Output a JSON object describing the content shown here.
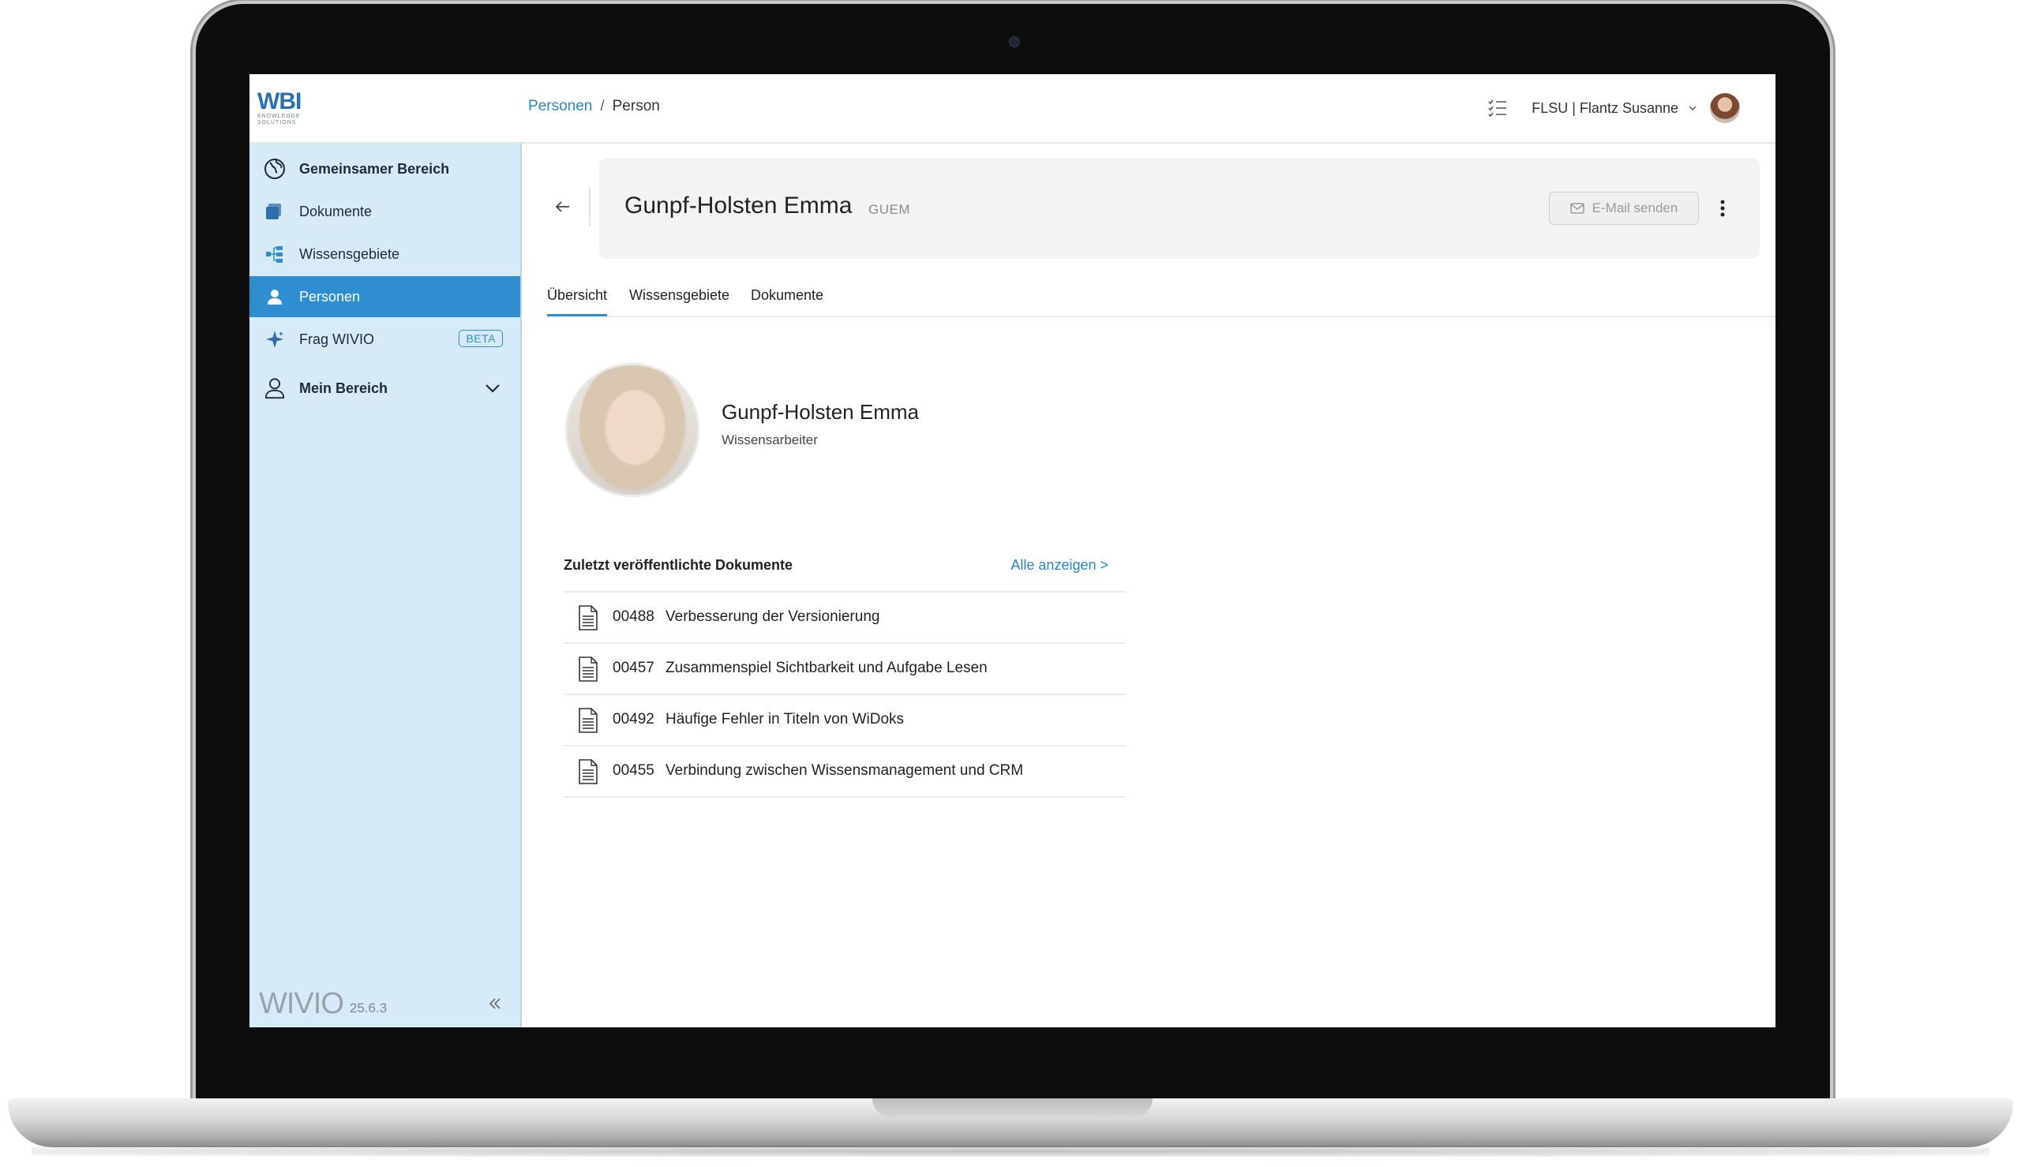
{
  "header": {
    "logo_main": "WBI",
    "logo_sub_1": "KNOWLEDGE",
    "logo_sub_2": "SOLUTIONS",
    "breadcrumb": {
      "link": "Personen",
      "separator": "/",
      "current": "Person"
    },
    "user_label": "FLSU | Flantz Susanne"
  },
  "sidebar": {
    "items": [
      {
        "label": "Gemeinsamer Bereich"
      },
      {
        "label": "Dokumente"
      },
      {
        "label": "Wissensgebiete"
      },
      {
        "label": "Personen"
      },
      {
        "label": "Frag WIVIO",
        "badge": "BETA"
      },
      {
        "label": "Mein Bereich"
      }
    ],
    "footer": {
      "logo": "WIVIO",
      "version": "25.6.3"
    }
  },
  "person": {
    "name": "Gunpf-Holsten Emma",
    "code": "GUEM",
    "role": "Wissensarbeiter",
    "mail_button": "E-Mail senden"
  },
  "tabs": [
    {
      "label": "Übersicht",
      "active": true
    },
    {
      "label": "Wissensgebiete"
    },
    {
      "label": "Dokumente"
    }
  ],
  "documents": {
    "heading": "Zuletzt veröffentlichte Dokumente",
    "show_all": "Alle anzeigen >",
    "items": [
      {
        "number": "00488",
        "title": "Verbesserung der Versionierung"
      },
      {
        "number": "00457",
        "title": "Zusammenspiel Sichtbarkeit und Aufgabe Lesen"
      },
      {
        "number": "00492",
        "title": "Häufige Fehler in Titeln von WiDoks"
      },
      {
        "number": "00455",
        "title": "Verbindung zwischen Wissensmanagement und CRM"
      }
    ]
  },
  "colors": {
    "accent": "#2f8ecf",
    "sidebar_bg": "#d6ebf7",
    "link": "#2a86c8"
  }
}
